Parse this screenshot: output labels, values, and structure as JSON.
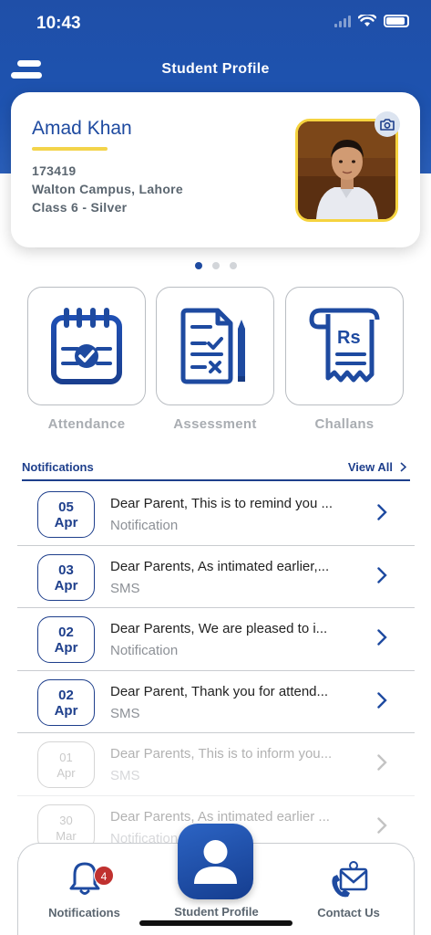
{
  "status_bar": {
    "time": "10:43"
  },
  "header": {
    "title": "Student Profile"
  },
  "profile": {
    "name": "Amad Khan",
    "id": "173419",
    "campus": "Walton Campus, Lahore",
    "class": "Class 6 - Silver"
  },
  "carousel": {
    "pages": 3,
    "active": 0
  },
  "tiles": [
    {
      "label": "Attendance",
      "icon": "calendar-check-icon"
    },
    {
      "label": "Assessment",
      "icon": "checklist-icon"
    },
    {
      "label": "Challans",
      "icon": "receipt-rupee-icon"
    }
  ],
  "notifications": {
    "title": "Notifications",
    "view_all": "View All",
    "items": [
      {
        "day": "05",
        "month": "Apr",
        "message": "Dear Parent, This is to remind you ...",
        "type": "Notification"
      },
      {
        "day": "03",
        "month": "Apr",
        "message": "Dear Parents, As intimated earlier,...",
        "type": "SMS"
      },
      {
        "day": "02",
        "month": "Apr",
        "message": "Dear Parents, We are pleased to i...",
        "type": "Notification"
      },
      {
        "day": "02",
        "month": "Apr",
        "message": "Dear Parent,  Thank you for attend...",
        "type": "SMS"
      },
      {
        "day": "01",
        "month": "Apr",
        "message": "Dear Parents, This is to inform you...",
        "type": "SMS"
      },
      {
        "day": "30",
        "month": "Mar",
        "message": "Dear Parents, As intimated earlier ...",
        "type": "Notification"
      }
    ]
  },
  "bottom_nav": {
    "notifications": {
      "label": "Notifications",
      "badge": "4"
    },
    "student_profile": {
      "label": "Student Profile"
    },
    "contact_us": {
      "label": "Contact Us"
    }
  },
  "colors": {
    "primary": "#1e4aa0",
    "accent": "#f3d44a",
    "badge": "#c0312f"
  }
}
